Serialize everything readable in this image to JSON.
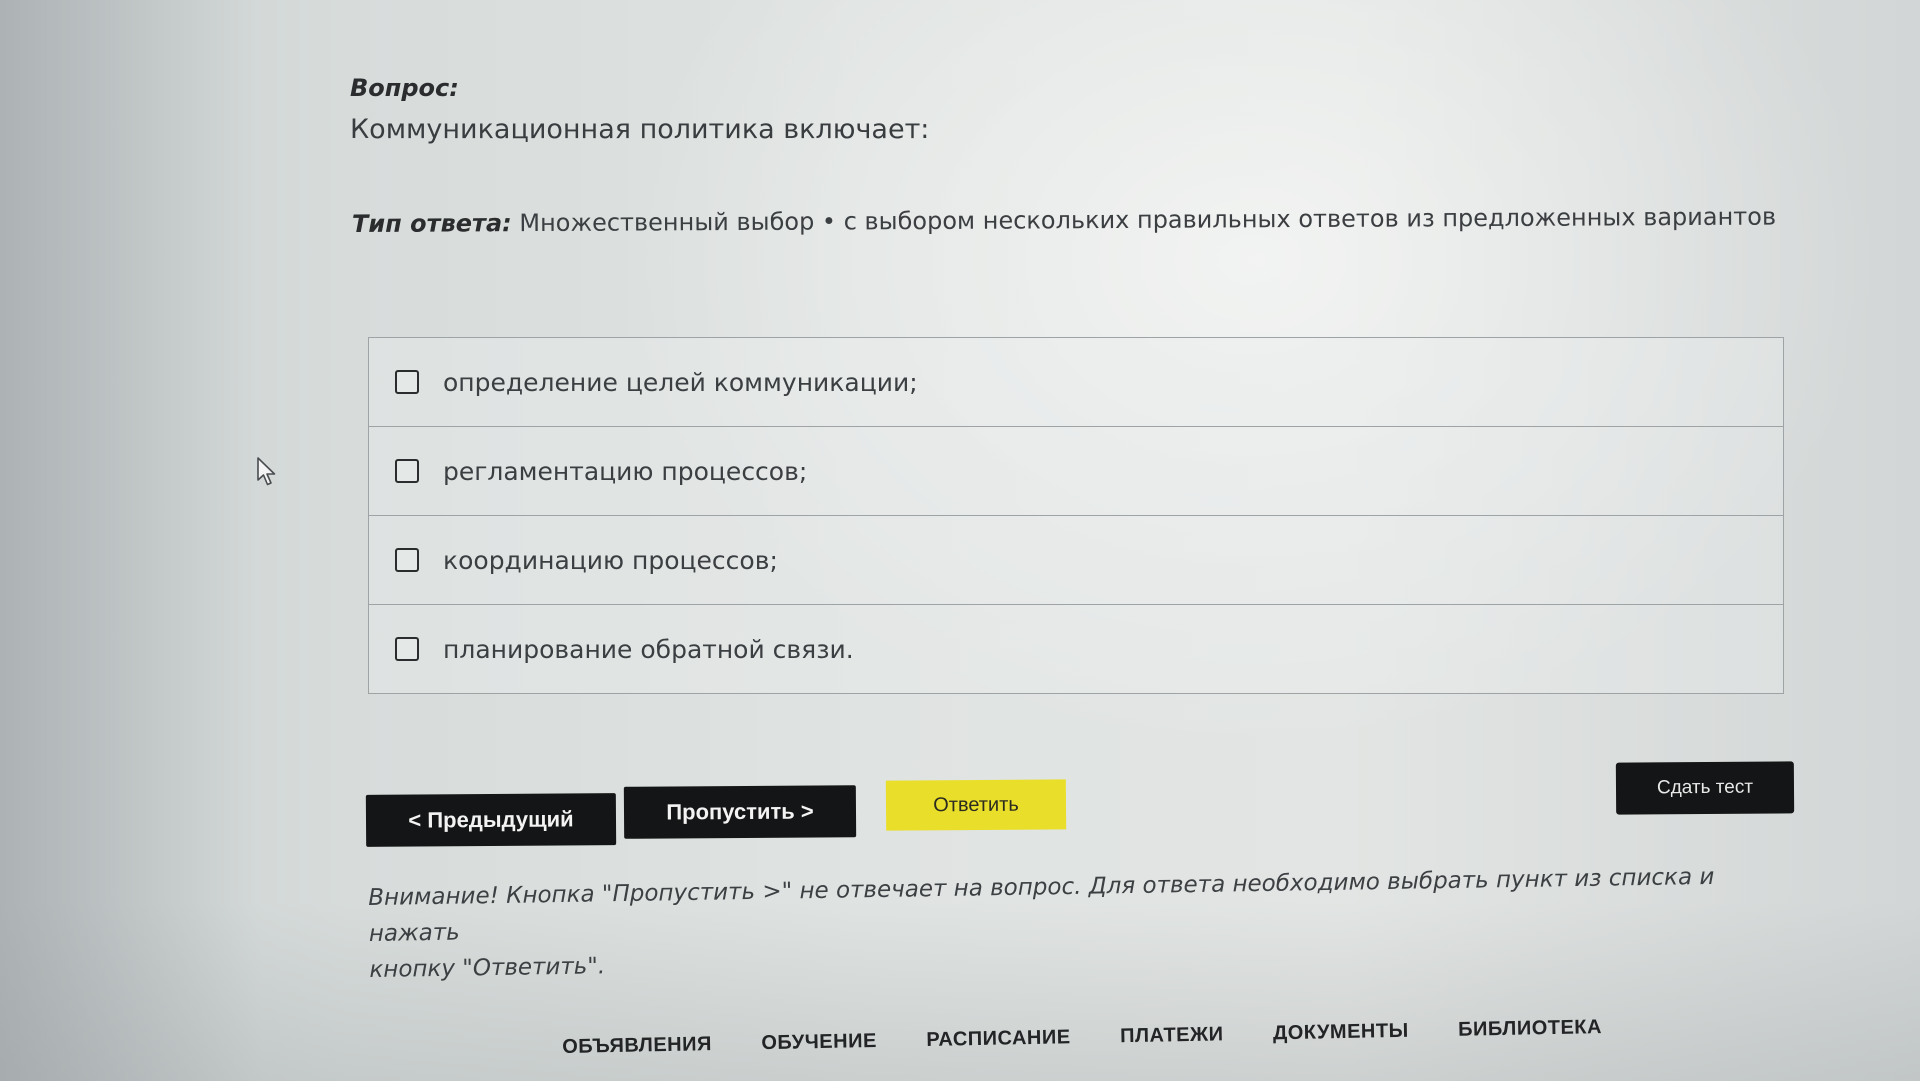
{
  "question": {
    "label": "Вопрос:",
    "text": "Коммуникационная политика включает:"
  },
  "answer_type": {
    "label": "Тип ответа:",
    "value": "Множественный выбор • с выбором нескольких правильных ответов из предложенных вариантов"
  },
  "options": [
    {
      "label": "определение целей коммуникации;",
      "checked": false
    },
    {
      "label": "регламентацию процессов;",
      "checked": false
    },
    {
      "label": "координацию процессов;",
      "checked": false
    },
    {
      "label": "планирование обратной связи.",
      "checked": false
    }
  ],
  "buttons": {
    "previous": "< Предыдущий",
    "skip": "Пропустить >",
    "answer": "Ответить",
    "submit_test": "Сдать тест"
  },
  "notice": {
    "line1": "Внимание! Кнопка \"Пропустить >\" не отвечает на вопрос. Для ответа необходимо выбрать пункт из списка и нажать",
    "line2": "кнопку \"Ответить\"."
  },
  "bottom_nav": [
    "ОБЪЯВЛЕНИЯ",
    "ОБУЧЕНИЕ",
    "РАСПИСАНИЕ",
    "ПЛАТЕЖИ",
    "ДОКУМЕНТЫ",
    "БИБЛИОТЕКА"
  ],
  "colors": {
    "answer_button": "#e9df2a",
    "dark_button": "#141516",
    "background": "#dfe3e1"
  },
  "icons": {
    "cursor": "mouse-pointer-icon"
  }
}
